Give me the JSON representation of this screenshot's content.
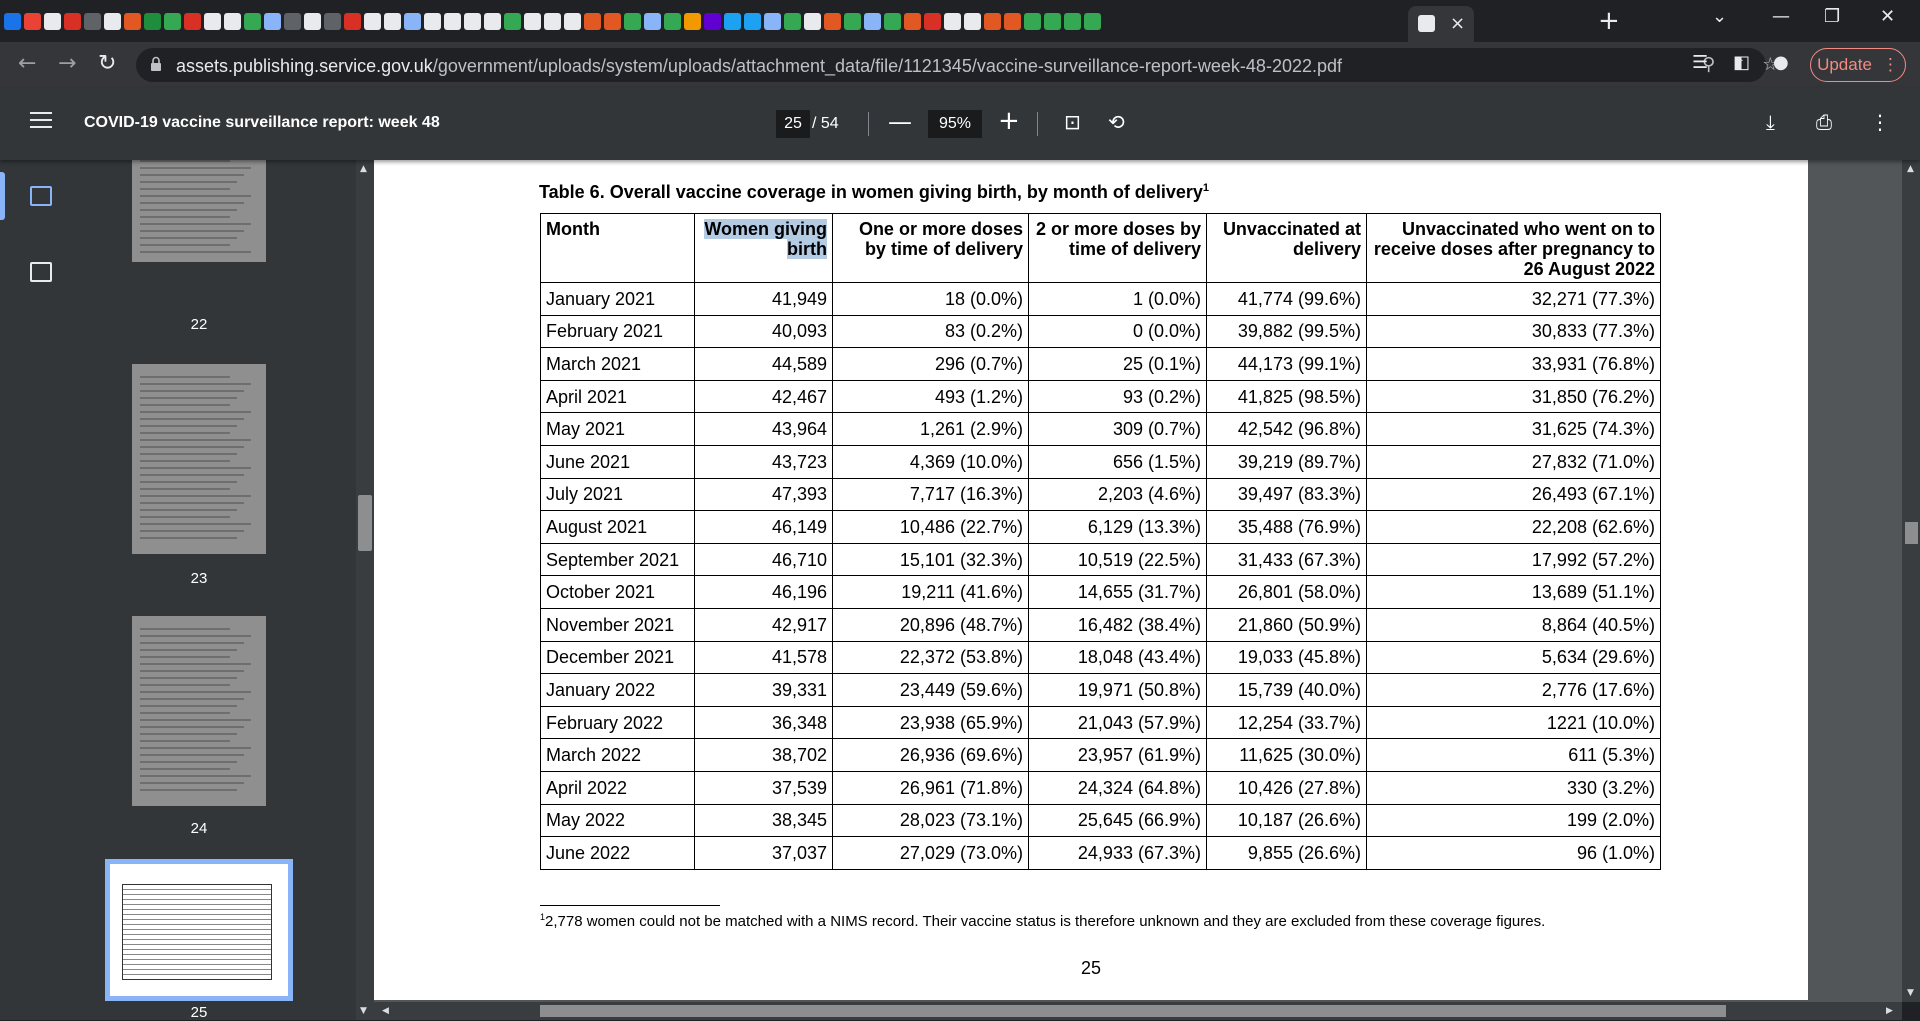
{
  "browser": {
    "active_tab_close": "×",
    "new_tab": "+",
    "url_host": "assets.publishing.service.gov.uk",
    "url_path": "/government/uploads/system/uploads/attachment_data/file/1121345/vaccine-surveillance-report-week-48-2022.pdf",
    "update_label": "Update",
    "favicon_colors": [
      "#1a73e8",
      "#ea4335",
      "#e8eaed",
      "#d93025",
      "#5f6368",
      "#e8eaed",
      "#e25822",
      "#1e8e3e",
      "#34a853",
      "#d93025",
      "#e8eaed",
      "#e8eaed",
      "#34a853",
      "#8ab4f8",
      "#5f6368",
      "#e8eaed",
      "#5f6368",
      "#d93025",
      "#e8eaed",
      "#e8eaed",
      "#8ab4f8",
      "#e8eaed",
      "#e8eaed",
      "#e8eaed",
      "#e8eaed",
      "#34a853",
      "#e8eaed",
      "#e8eaed",
      "#e8eaed",
      "#e25822",
      "#e25822",
      "#34a853",
      "#8ab4f8",
      "#34a853",
      "#f29900",
      "#6001d2",
      "#1da1f2",
      "#1da1f2",
      "#8ab4f8",
      "#34a853",
      "#e8eaed",
      "#e25822",
      "#34a853",
      "#8ab4f8",
      "#34a853",
      "#e25822",
      "#d93025",
      "#e8eaed",
      "#e8eaed",
      "#e25822",
      "#e25822",
      "#34a853",
      "#34a853",
      "#34a853",
      "#34a853"
    ]
  },
  "viewer": {
    "title": "COVID-19 vaccine surveillance report: week 48",
    "current_page": "25",
    "total_pages": "/  54",
    "zoom": "95%",
    "thumbnails": [
      {
        "label": "22"
      },
      {
        "label": "23"
      },
      {
        "label": "24"
      },
      {
        "label": "25"
      }
    ]
  },
  "document": {
    "table_title": "Table 6. Overall vaccine coverage in women giving birth, by month of delivery",
    "table_title_sup": "1",
    "headers": [
      "Month",
      "Women giving birth",
      "One or more doses by time of delivery",
      "2 or more doses by time of delivery",
      "Unvaccinated at delivery",
      "Unvaccinated who went on to receive doses after pregnancy to 26 August 2022"
    ],
    "rows": [
      [
        "January 2021",
        "41,949",
        "18 (0.0%)",
        "1 (0.0%)",
        "41,774 (99.6%)",
        "32,271 (77.3%)"
      ],
      [
        "February 2021",
        "40,093",
        "83 (0.2%)",
        "0 (0.0%)",
        "39,882 (99.5%)",
        "30,833 (77.3%)"
      ],
      [
        "March 2021",
        "44,589",
        "296 (0.7%)",
        "25 (0.1%)",
        "44,173 (99.1%)",
        "33,931 (76.8%)"
      ],
      [
        "April 2021",
        "42,467",
        "493 (1.2%)",
        "93 (0.2%)",
        "41,825 (98.5%)",
        "31,850 (76.2%)"
      ],
      [
        "May 2021",
        "43,964",
        "1,261 (2.9%)",
        "309 (0.7%)",
        "42,542 (96.8%)",
        "31,625 (74.3%)"
      ],
      [
        "June 2021",
        "43,723",
        "4,369 (10.0%)",
        "656 (1.5%)",
        "39,219 (89.7%)",
        "27,832 (71.0%)"
      ],
      [
        "July 2021",
        "47,393",
        "7,717 (16.3%)",
        "2,203 (4.6%)",
        "39,497 (83.3%)",
        "26,493 (67.1%)"
      ],
      [
        "August 2021",
        "46,149",
        "10,486 (22.7%)",
        "6,129 (13.3%)",
        "35,488 (76.9%)",
        "22,208 (62.6%)"
      ],
      [
        "September 2021",
        "46,710",
        "15,101 (32.3%)",
        "10,519 (22.5%)",
        "31,433 (67.3%)",
        "17,992 (57.2%)"
      ],
      [
        "October 2021",
        "46,196",
        "19,211 (41.6%)",
        "14,655 (31.7%)",
        "26,801 (58.0%)",
        "13,689 (51.1%)"
      ],
      [
        "November 2021",
        "42,917",
        "20,896 (48.7%)",
        "16,482 (38.4%)",
        "21,860 (50.9%)",
        "8,864 (40.5%)"
      ],
      [
        "December 2021",
        "41,578",
        "22,372 (53.8%)",
        "18,048 (43.4%)",
        "19,033 (45.8%)",
        "5,634 (29.6%)"
      ],
      [
        "January 2022",
        "39,331",
        "23,449 (59.6%)",
        "19,971 (50.8%)",
        "15,739 (40.0%)",
        "2,776 (17.6%)"
      ],
      [
        "February 2022",
        "36,348",
        "23,938 (65.9%)",
        "21,043 (57.9%)",
        "12,254 (33.7%)",
        "1221 (10.0%)"
      ],
      [
        "March 2022",
        "38,702",
        "26,936 (69.6%)",
        "23,957 (61.9%)",
        "11,625 (30.0%)",
        "611 (5.3%)"
      ],
      [
        "April 2022",
        "37,539",
        "26,961 (71.8%)",
        "24,324 (64.8%)",
        "10,426 (27.8%)",
        "330 (3.2%)"
      ],
      [
        "May 2022",
        "38,345",
        "28,023 (73.1%)",
        "25,645 (66.9%)",
        "10,187 (26.6%)",
        "199 (2.0%)"
      ],
      [
        "June 2022",
        "37,037",
        "27,029 (73.0%)",
        "24,933 (67.3%)",
        "9,855 (26.6%)",
        "96 (1.0%)"
      ]
    ],
    "footnote_sup": "1",
    "footnote": "2,778 women could not be matched with a NIMS record. Their vaccine status is therefore unknown and they are excluded from these coverage figures.",
    "page_number": "25"
  }
}
